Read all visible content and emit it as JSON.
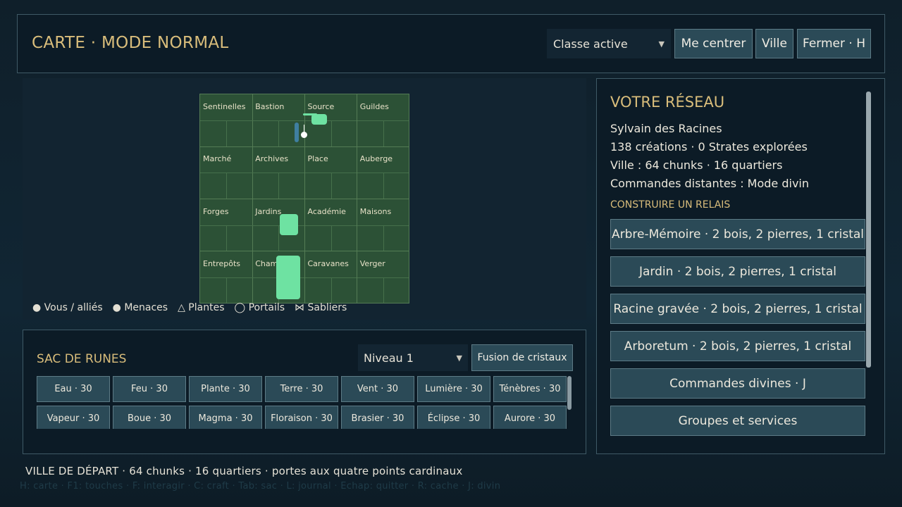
{
  "header": {
    "title": "CARTE · MODE NORMAL",
    "class_select": "Classe active",
    "btn_center": "Me centrer",
    "btn_city": "Ville",
    "btn_close": "Fermer · H"
  },
  "map": {
    "cells": [
      "Sentinelles",
      "Bastion",
      "Source",
      "Guildes",
      "Marché",
      "Archives",
      "Place",
      "Auberge",
      "Forges",
      "Jardins",
      "Académie",
      "Maisons",
      "Entrepôts",
      "Cham",
      "Caravanes",
      "Verger"
    ],
    "legend": [
      "● Vous / alliés",
      "● Menaces",
      "△ Plantes",
      "◯ Portails",
      "⋈ Sabliers"
    ]
  },
  "runes": {
    "title": "SAC DE RUNES",
    "level_select": "Niveau 1",
    "fusion_button": "Fusion de cristaux",
    "items": [
      "Eau · 30",
      "Feu · 30",
      "Plante · 30",
      "Terre · 30",
      "Vent · 30",
      "Lumière · 30",
      "Ténèbres · 30",
      "Vapeur · 30",
      "Boue · 30",
      "Magma · 30",
      "Floraison · 30",
      "Brasier · 30",
      "Éclipse · 30",
      "Aurore · 30"
    ]
  },
  "network": {
    "title": "VOTRE RÉSEAU",
    "player": "Sylvain des Racines",
    "stats": "138 créations · 0 Strates explorées",
    "city": "Ville : 64 chunks · 16 quartiers",
    "commands": "Commandes distantes : Mode divin",
    "relay_heading": "CONSTRUIRE UN RELAIS",
    "relays": [
      "Arbre-Mémoire · 2 bois, 2 pierres, 1 cristal",
      "Jardin · 2 bois, 2 pierres, 1 cristal",
      "Racine gravée · 2 bois, 2 pierres, 1 cristal",
      "Arboretum · 2 bois, 2 pierres, 1 cristal",
      "Commandes divines · J",
      "Groupes et services"
    ]
  },
  "footer": {
    "text": "VILLE DE DÉPART · 64 chunks · 16 quartiers · portes aux quatre points cardinaux",
    "hint": "H: carte · F1: touches · F: interagir · C: craft · Tab: sac · L: journal · Echap: quitter · R: cache · J: divin"
  },
  "colors": {
    "accent_gold": "#d9bd7b",
    "map_green": "#2c5136",
    "marker_green": "#6ee2a2"
  }
}
